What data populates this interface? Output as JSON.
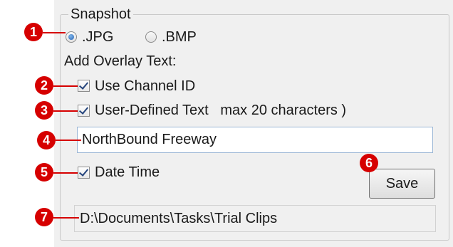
{
  "snapshot": {
    "title": "Snapshot",
    "format_options": [
      {
        "label": ".JPG",
        "selected": true
      },
      {
        "label": ".BMP",
        "selected": false
      }
    ],
    "overlay_heading": "Add Overlay Text:",
    "use_channel_id": {
      "label": "Use Channel ID",
      "checked": true
    },
    "user_defined_text": {
      "label": "User-Defined Text   max 20 characters )",
      "checked": true
    },
    "overlay_text_value": "NorthBound Freeway",
    "date_time": {
      "label": "Date Time",
      "checked": true
    },
    "save_label": "Save",
    "path": "D:\\Documents\\Tasks\\Trial Clips"
  },
  "callouts": [
    "1",
    "2",
    "3",
    "4",
    "5",
    "6",
    "7"
  ],
  "colors": {
    "callout": "#d60000",
    "panel_background": "#f0f0f0",
    "radio_dot": "#2a64b4"
  }
}
